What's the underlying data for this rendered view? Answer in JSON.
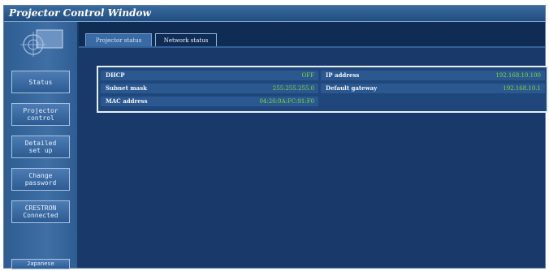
{
  "window": {
    "title": "Projector Control Window"
  },
  "sidebar": {
    "buttons": [
      {
        "label": "Status"
      },
      {
        "label": "Projector\ncontrol"
      },
      {
        "label": "Detailed\nset up"
      },
      {
        "label": "Change\npassword"
      },
      {
        "label": "CRESTRON\nConnected"
      }
    ],
    "language": "Japanese"
  },
  "tabs": [
    {
      "label": "Projector status",
      "active": false
    },
    {
      "label": "Network status",
      "active": true
    }
  ],
  "network": {
    "dhcp": {
      "label": "DHCP",
      "value": "OFF"
    },
    "ip": {
      "label": "IP address",
      "value": "192.168.10.100"
    },
    "subnet": {
      "label": "Subnet mask",
      "value": "255.255.255.0"
    },
    "gateway": {
      "label": "Default gateway",
      "value": "192.168.10.1"
    },
    "mac": {
      "label": "MAC address",
      "value": "04:20:9A:FC:91:F0"
    }
  },
  "colors": {
    "value_text": "#7edb3a",
    "background": "#163b68"
  }
}
